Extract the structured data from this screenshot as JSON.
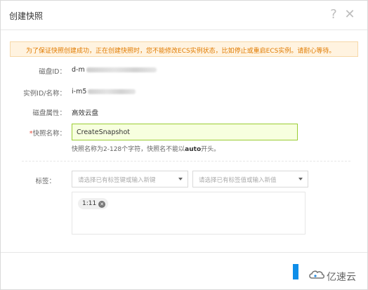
{
  "dialog": {
    "title": "创建快照",
    "help_glyph": "?",
    "close_glyph": "✕"
  },
  "alert": {
    "text": "为了保证快照创建成功，正在创建快照时，您不能修改ECS实例状态，比如停止或重启ECS实例。请耐心等待。"
  },
  "fields": {
    "disk_id_label": "磁盘ID：",
    "disk_id_value": "d-m",
    "instance_label": "实例ID/名称：",
    "instance_value": "i-m5",
    "disk_attr_label": "磁盘属性：",
    "disk_attr_value": "高效云盘",
    "snapshot_name_star": "*",
    "snapshot_name_label": "快照名称：",
    "snapshot_name_value": "CreateSnapshot",
    "hint_prefix": "快照名称为2-128个字符，快照名不能以",
    "hint_bold": "auto",
    "hint_suffix": "开头。"
  },
  "tags": {
    "label": "标签：",
    "key_placeholder": "请选择已有标签键或输入新键",
    "value_placeholder": "请选择已有标签值或输入新值",
    "items": [
      {
        "text": "1:11",
        "remove_glyph": "✕"
      }
    ]
  },
  "logo": {
    "text": "亿速云"
  },
  "colors": {
    "alert_text": "#e07b00",
    "alert_bg": "#fff3e0",
    "input_border": "#9acd32",
    "input_bg": "#f7ffdf",
    "primary": "#0e8ee9",
    "required": "#e74c3c"
  }
}
